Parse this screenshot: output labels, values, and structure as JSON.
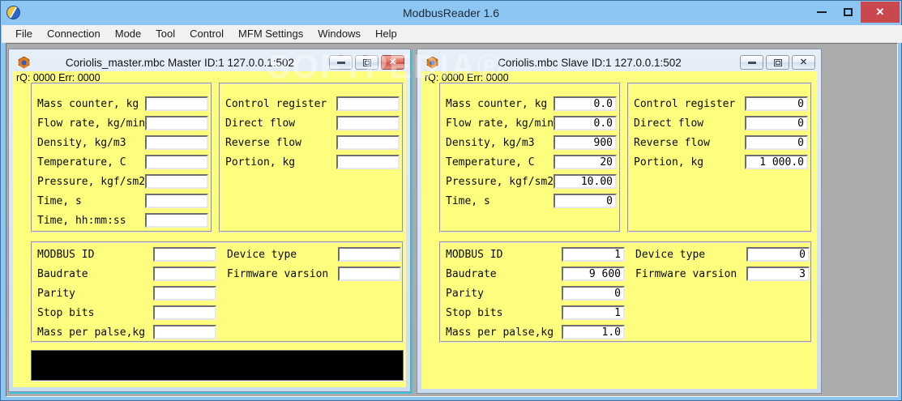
{
  "app": {
    "title": "ModbusReader 1.6",
    "menu_items": [
      "File",
      "Connection",
      "Mode",
      "Tool",
      "Control",
      "MFM Settings",
      "Windows",
      "Help"
    ],
    "controls": {
      "close": "✕"
    }
  },
  "mdi": {
    "watermark": "SOFTPEDIA®"
  },
  "windows": [
    {
      "title": "Coriolis_master.mbc Master ID:1 127.0.0.1:502",
      "status": "rQ: 0000 Err: 0000",
      "controls": {
        "close": "✕"
      },
      "process": [
        {
          "label": "Mass counter, kg",
          "value": ""
        },
        {
          "label": "Flow rate, kg/min",
          "value": ""
        },
        {
          "label": "Density, kg/m3",
          "value": ""
        },
        {
          "label": "Temperature, C",
          "value": ""
        },
        {
          "label": "Pressure, kgf/sm2",
          "value": ""
        },
        {
          "label": "Time, s",
          "value": ""
        },
        {
          "label": "Time, hh:mm:ss",
          "value": ""
        }
      ],
      "totals": [
        {
          "label": "Control register",
          "value": ""
        },
        {
          "label": "Direct flow",
          "value": ""
        },
        {
          "label": "Reverse flow",
          "value": ""
        },
        {
          "label": "Portion, kg",
          "value": ""
        }
      ],
      "comm": [
        {
          "label": "MODBUS ID",
          "value": ""
        },
        {
          "label": "Baudrate",
          "value": ""
        },
        {
          "label": "Parity",
          "value": ""
        },
        {
          "label": "Stop bits",
          "value": ""
        },
        {
          "label": "Mass per palse,kg",
          "value": ""
        }
      ],
      "device": [
        {
          "label": "Device type",
          "value": ""
        },
        {
          "label": "Firmware varsion",
          "value": ""
        }
      ]
    },
    {
      "title": "Coriolis.mbc Slave ID:1 127.0.0.1:502",
      "status": "rQ: 0000 Err: 0000",
      "controls": {
        "close": "✕"
      },
      "process": [
        {
          "label": "Mass counter, kg",
          "value": "0.0"
        },
        {
          "label": "Flow rate, kg/min",
          "value": "0.0"
        },
        {
          "label": "Density, kg/m3",
          "value": "900"
        },
        {
          "label": "Temperature, C",
          "value": "20"
        },
        {
          "label": "Pressure, kgf/sm2",
          "value": "10.00"
        },
        {
          "label": "Time, s",
          "value": "0"
        }
      ],
      "totals": [
        {
          "label": "Control register",
          "value": "0"
        },
        {
          "label": "Direct flow",
          "value": "0"
        },
        {
          "label": "Reverse flow",
          "value": "0"
        },
        {
          "label": "Portion, kg",
          "value": "1 000.0"
        }
      ],
      "comm": [
        {
          "label": "MODBUS ID",
          "value": "1"
        },
        {
          "label": "Baudrate",
          "value": "9 600"
        },
        {
          "label": "Parity",
          "value": "0"
        },
        {
          "label": "Stop bits",
          "value": "1"
        },
        {
          "label": "Mass per palse,kg",
          "value": "1.0"
        }
      ],
      "device": [
        {
          "label": "Device type",
          "value": "0"
        },
        {
          "label": "Firmware varsion",
          "value": "3"
        }
      ]
    }
  ]
}
